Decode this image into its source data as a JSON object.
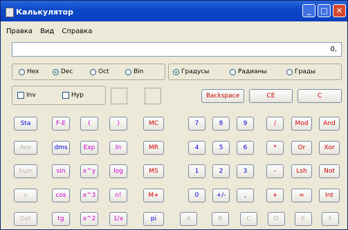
{
  "title": "Калькулятор",
  "window_controls": {
    "minimize": "_",
    "maximize": "□",
    "close": "✕"
  },
  "menu": [
    "Правка",
    "Вид",
    "Справка"
  ],
  "display": "0,",
  "base_options": [
    {
      "label": "Hex",
      "checked": false
    },
    {
      "label": "Dec",
      "checked": true
    },
    {
      "label": "Oct",
      "checked": false
    },
    {
      "label": "Bin",
      "checked": false
    }
  ],
  "angle_options": [
    {
      "label": "Градусы",
      "checked": true
    },
    {
      "label": "Радианы",
      "checked": false
    },
    {
      "label": "Грады",
      "checked": false
    }
  ],
  "checkboxes": {
    "inv": "Inv",
    "hyp": "Hyp"
  },
  "top_buttons": {
    "backspace": "Backspace",
    "ce": "CE",
    "c": "C"
  },
  "left_col": [
    "Sta",
    "Ave",
    "Sum",
    "s",
    "Dat"
  ],
  "sci_rows": [
    [
      "F-E",
      "(",
      ")"
    ],
    [
      "dms",
      "Exp",
      "ln"
    ],
    [
      "sin",
      "x^y",
      "log"
    ],
    [
      "cos",
      "x^3",
      "n!"
    ],
    [
      "tg",
      "x^2",
      "1/x"
    ]
  ],
  "memory": [
    "MC",
    "MR",
    "MS",
    "M+",
    "pi"
  ],
  "keypad_rows": [
    [
      "7",
      "8",
      "9",
      "/",
      "Mod",
      "And"
    ],
    [
      "4",
      "5",
      "6",
      "*",
      "Or",
      "Xor"
    ],
    [
      "1",
      "2",
      "3",
      "-",
      "Lsh",
      "Not"
    ],
    [
      "0",
      "+/-",
      ",",
      "+",
      "=",
      "Int"
    ],
    [
      "A",
      "B",
      "C",
      "D",
      "E",
      "F"
    ]
  ]
}
